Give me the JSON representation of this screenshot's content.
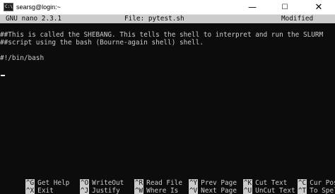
{
  "window": {
    "title": "searsg@login:~",
    "icon_text": "C:\\",
    "minimize_glyph": "—",
    "maximize_glyph": "☐",
    "close_glyph": "✕"
  },
  "nano": {
    "version": "GNU nano 2.3.1",
    "file": "File: pytest.sh",
    "status": "Modified"
  },
  "buffer": {
    "lines": [
      "##This is called the SHEBANG. This tells the shell to interpret and run the SLURM",
      "##script using the bash (Bourne-again shell) shell.",
      "",
      "#!/bin/bash"
    ]
  },
  "shortcuts": {
    "row1": [
      {
        "key": "^G",
        "label": "Get Help"
      },
      {
        "key": "^O",
        "label": "WriteOut"
      },
      {
        "key": "^R",
        "label": "Read File"
      },
      {
        "key": "^Y",
        "label": "Prev Page"
      },
      {
        "key": "^K",
        "label": "Cut Text"
      },
      {
        "key": "^C",
        "label": "Cur Pos"
      }
    ],
    "row2": [
      {
        "key": "^X",
        "label": "Exit"
      },
      {
        "key": "^J",
        "label": "Justify"
      },
      {
        "key": "^W",
        "label": "Where Is"
      },
      {
        "key": "^V",
        "label": "Next Page"
      },
      {
        "key": "^U",
        "label": "UnCut Text"
      },
      {
        "key": "^T",
        "label": "To Spell"
      }
    ]
  },
  "colors": {
    "terminal_bg": "#0c0c0c",
    "terminal_fg": "#cccccc",
    "titlebar_bg": "#ffffff"
  }
}
